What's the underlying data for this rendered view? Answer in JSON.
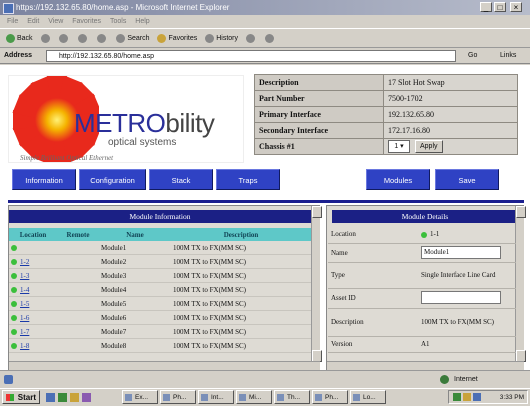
{
  "window": {
    "title": "https://192.132.65.80/home.asp - Microsoft Internet Explorer",
    "minimize": "_",
    "maximize": "□",
    "close": "×"
  },
  "menu": [
    "File",
    "Edit",
    "View",
    "Favorites",
    "Tools",
    "Help"
  ],
  "toolbar": {
    "back": "Back",
    "search": "Search",
    "favorites": "Favorites",
    "history": "History"
  },
  "address": {
    "label": "Address",
    "url": "http://192.132.65.80/home.asp",
    "go": "Go",
    "links": "Links"
  },
  "logo": {
    "brand_part1": "METRO",
    "brand_part2": "bility",
    "subtitle": "optical systems",
    "tagline": "Simple Brilliant Optical Ethernet"
  },
  "device": {
    "rows": [
      {
        "label": "Description",
        "value": "17 Slot Hot Swap"
      },
      {
        "label": "Part Number",
        "value": "7500-1702"
      },
      {
        "label": "Primary Interface",
        "value": "192.132.65.80"
      },
      {
        "label": "Secondary Interface",
        "value": "172.17.16.80"
      }
    ],
    "chassis_label": "Chassis #1",
    "chassis_value": "1",
    "apply_label": "Apply"
  },
  "nav": {
    "information": "Information",
    "configuration": "Configuration",
    "stack": "Stack",
    "traps": "Traps",
    "modules": "Modules",
    "save": "Save"
  },
  "module_info": {
    "title": "Module Information",
    "headers": [
      "Location",
      "Remote",
      "Name",
      "Description"
    ],
    "rows": [
      {
        "location": "",
        "remote": "",
        "name": "Module1",
        "description": "100M TX to FX(MM SC)"
      },
      {
        "location": "1-2",
        "remote": "",
        "name": "Module2",
        "description": "100M TX to FX(MM SC)"
      },
      {
        "location": "1-3",
        "remote": "",
        "name": "Module3",
        "description": "100M TX to FX(MM SC)"
      },
      {
        "location": "1-4",
        "remote": "",
        "name": "Module4",
        "description": "100M TX to FX(MM SC)"
      },
      {
        "location": "1-5",
        "remote": "",
        "name": "Module5",
        "description": "100M TX to FX(MM SC)"
      },
      {
        "location": "1-6",
        "remote": "",
        "name": "Module6",
        "description": "100M TX to FX(MM SC)"
      },
      {
        "location": "1-7",
        "remote": "",
        "name": "Module7",
        "description": "100M TX to FX(MM SC)"
      },
      {
        "location": "1-8",
        "remote": "",
        "name": "Module8",
        "description": "100M TX to FX(MM SC)"
      }
    ],
    "status_color": "#3bbf3b"
  },
  "module_details": {
    "title": "Module Details",
    "location_label": "Location",
    "location_value": "1-1",
    "name_label": "Name",
    "name_value": "Module1",
    "type_label": "Type",
    "type_value": "Single Interface Line Card",
    "asset_label": "Asset ID",
    "asset_value": "",
    "description_label": "Description",
    "description_value": "100M TX to FX(MM SC)",
    "version_label": "Version",
    "version_value": "A1"
  },
  "status": {
    "text": "Internet"
  },
  "taskbar": {
    "start": "Start",
    "tasks": [
      "Ex...",
      "Ph...",
      "Int...",
      "Mi...",
      "Th...",
      "Ph...",
      "Lo..."
    ],
    "clock": "3:33 PM"
  },
  "colors": {
    "nav_blue": "#2f42c4",
    "header_navy": "#1b2085",
    "table_header_cyan": "#5ec8c8"
  }
}
